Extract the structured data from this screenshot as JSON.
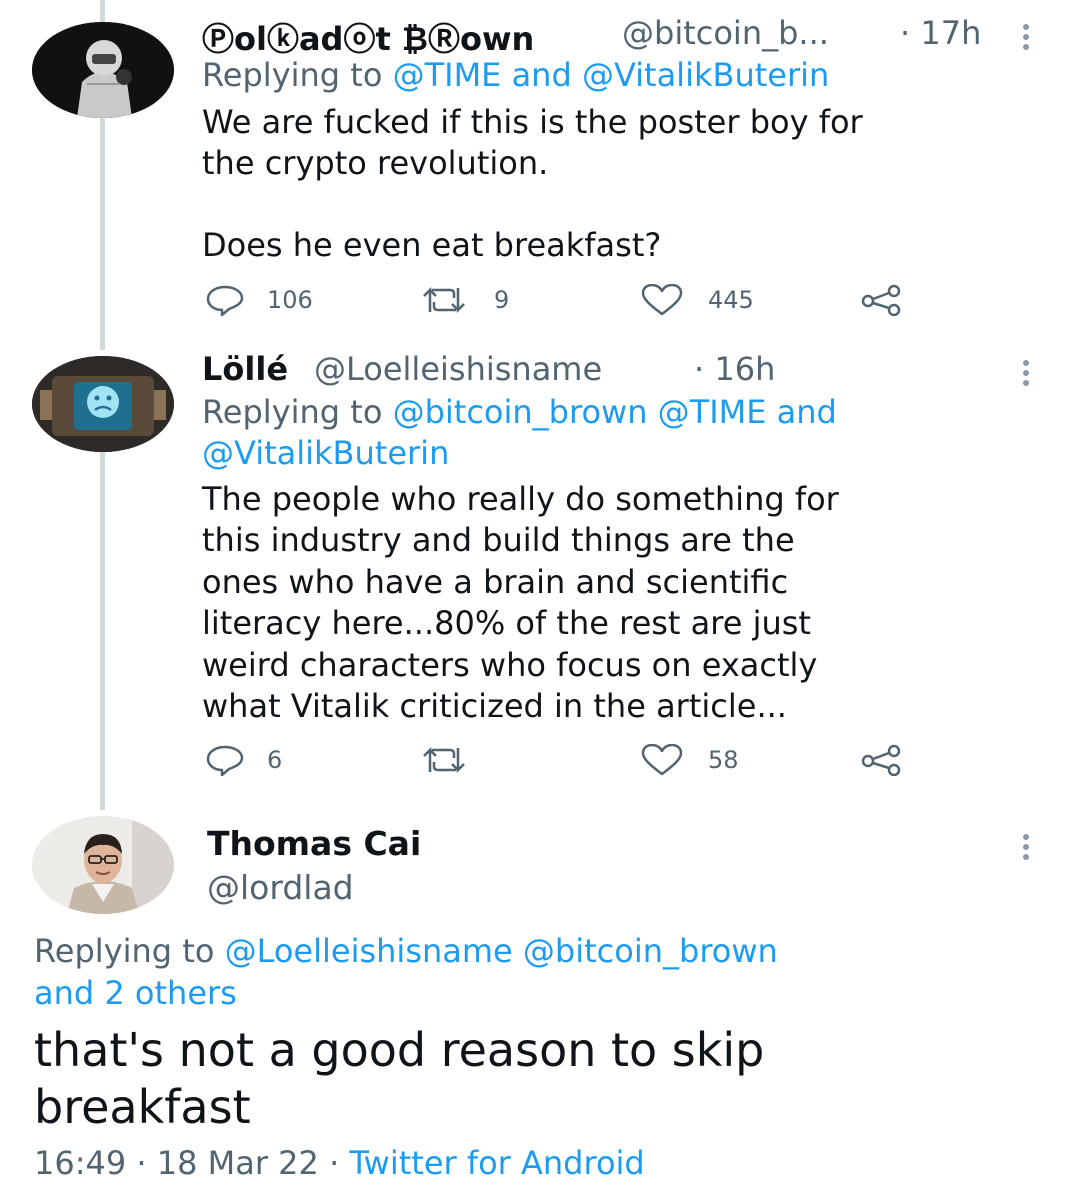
{
  "tweets": [
    {
      "display_name": "Ⓟolⓚadⓞt ₿Ⓡown",
      "handle": "@bitcoin_b...",
      "time": "· 17h",
      "replying_label": "Replying to",
      "replying_to": "@TIME and @VitalikButerin",
      "text_lines": [
        "We are fucked if this is the poster boy for",
        "the crypto revolution.",
        "",
        "Does he even eat breakfast?"
      ],
      "replies": "106",
      "retweets": "9",
      "likes": "445",
      "avatar_icon": "hazmat-suit-avatar"
    },
    {
      "display_name": "Löllé",
      "handle": "@Loelleishisname",
      "time": "· 16h",
      "replying_label": "Replying to",
      "replying_to_line1": "@bitcoin_brown @TIME and",
      "replying_to_line2": "@VitalikButerin",
      "text_lines": [
        "The people who really do something for",
        "this industry and build things are the",
        "ones who have a brain and scientific",
        "literacy here...80% of the rest are just",
        "weird characters who focus on exactly",
        "what Vitalik criticized in the article..."
      ],
      "replies": "6",
      "retweets": "",
      "likes": "58",
      "avatar_icon": "sad-robot-avatar"
    }
  ],
  "main_tweet": {
    "display_name": "Thomas Cai",
    "handle": "@lordlad",
    "replying_label": "Replying to",
    "replying_to_line1": "@Loelleishisname @bitcoin_brown",
    "replying_to_line2": "and 2 others",
    "text_lines": [
      "that's not a good reason to skip",
      "breakfast"
    ],
    "timestamp": "16:49 · 18 Mar 22 ·",
    "source": "Twitter for Android",
    "avatar_icon": "person-photo-avatar"
  },
  "colors": {
    "link": "#1d9bf0",
    "muted": "#536471",
    "text": "#0f1419"
  }
}
